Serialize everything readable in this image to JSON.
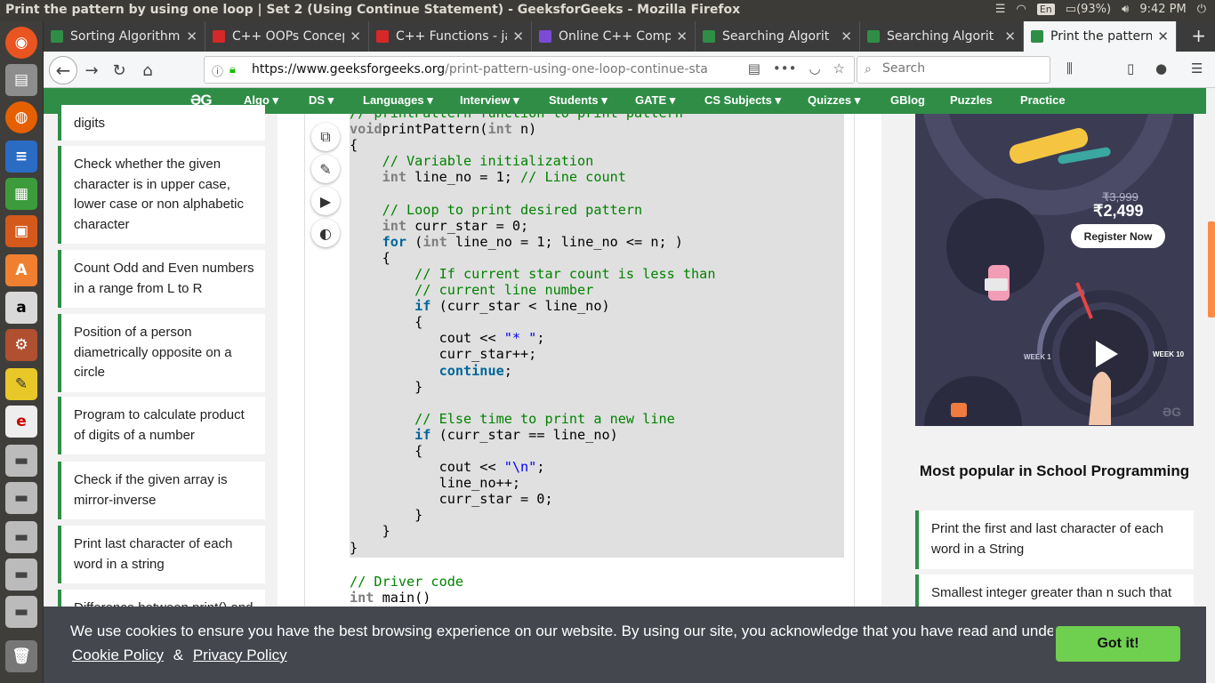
{
  "window": {
    "title": "Print the pattern by using one loop | Set 2 (Using Continue Statement) - GeeksforGeeks - Mozilla Firefox"
  },
  "system_tray": {
    "keyboard": "En",
    "battery": "(93%)",
    "clock": "9:42 PM"
  },
  "tabs": [
    {
      "title": "Sorting Algorithm",
      "icon_color": "#2f8d46",
      "icon": "gfg-icon",
      "active": false
    },
    {
      "title": "C++ OOPs Concep",
      "icon_color": "#d62828",
      "icon": "v-icon",
      "active": false
    },
    {
      "title": "C++ Functions - ja",
      "icon_color": "#d62828",
      "icon": "v-icon",
      "active": false
    },
    {
      "title": "Online C++ Compi",
      "icon_color": "#7b4bd8",
      "icon": "bolt-icon",
      "active": false
    },
    {
      "title": "Searching Algorit",
      "icon_color": "#2f8d46",
      "icon": "gfg-icon",
      "active": false
    },
    {
      "title": "Searching Algorit",
      "icon_color": "#2f8d46",
      "icon": "gfg-icon",
      "active": false
    },
    {
      "title": "Print the pattern b",
      "icon_color": "#2f8d46",
      "icon": "gfg-icon",
      "active": true
    }
  ],
  "navbar": {
    "url_domain": "https://www.geeksforgeeks.org",
    "url_path": "/print-pattern-using-one-loop-continue-sta",
    "search_placeholder": "Search"
  },
  "gfg_menu": {
    "logo": "ƏG",
    "items": [
      "Algo ▾",
      "DS ▾",
      "Languages ▾",
      "Interview ▾",
      "Students ▾",
      "GATE ▾",
      "CS Subjects ▾",
      "Quizzes ▾",
      "GBlog",
      "Puzzles",
      "Practice"
    ]
  },
  "left_sidebar": {
    "items": [
      "digits",
      "Check whether the given character is in upper case, lower case or non alphabetic character",
      "Count Odd and Even numbers in a range from L to R",
      "Position of a person diametrically opposite on a circle",
      "Program to calculate product of digits of a number",
      "Check if the given array is mirror-inverse",
      "Print last character of each word in a string",
      "Difference between print() and"
    ]
  },
  "code_lines": [
    [
      [
        "cm",
        "// printPattern function to print pattern"
      ]
    ],
    [
      [
        "ty",
        "void"
      ],
      [
        "",
        "printPattern("
      ],
      [
        "ty",
        "int"
      ],
      [
        "",
        " n)"
      ]
    ],
    [
      [
        "",
        "{"
      ]
    ],
    [
      [
        "",
        "    "
      ],
      [
        "cm",
        "// Variable initialization"
      ]
    ],
    [
      [
        "",
        "    "
      ],
      [
        "ty",
        "int"
      ],
      [
        "",
        " line_no = 1; "
      ],
      [
        "cm",
        "// Line count"
      ]
    ],
    [
      [
        "",
        ""
      ]
    ],
    [
      [
        "",
        "    "
      ],
      [
        "cm",
        "// Loop to print desired pattern"
      ]
    ],
    [
      [
        "",
        "    "
      ],
      [
        "ty",
        "int"
      ],
      [
        "",
        " curr_star = 0;"
      ]
    ],
    [
      [
        "",
        "    "
      ],
      [
        "kw",
        "for"
      ],
      [
        "",
        " ("
      ],
      [
        "ty",
        "int"
      ],
      [
        "",
        " line_no = 1; line_no <= n; )"
      ]
    ],
    [
      [
        "",
        "    {"
      ]
    ],
    [
      [
        "",
        "        "
      ],
      [
        "cm",
        "// If current star count is less than"
      ]
    ],
    [
      [
        "",
        "        "
      ],
      [
        "cm",
        "// current line number"
      ]
    ],
    [
      [
        "",
        "        "
      ],
      [
        "kw",
        "if"
      ],
      [
        "",
        " (curr_star < line_no)"
      ]
    ],
    [
      [
        "",
        "        {"
      ]
    ],
    [
      [
        "",
        "           cout << "
      ],
      [
        "st",
        "\"* \""
      ],
      [
        "",
        ";"
      ]
    ],
    [
      [
        "",
        "           curr_star++;"
      ]
    ],
    [
      [
        "",
        "           "
      ],
      [
        "kw",
        "continue"
      ],
      [
        "",
        ";"
      ]
    ],
    [
      [
        "",
        "        }"
      ]
    ],
    [
      [
        "",
        ""
      ]
    ],
    [
      [
        "",
        "        "
      ],
      [
        "cm",
        "// Else time to print a new line"
      ]
    ],
    [
      [
        "",
        "        "
      ],
      [
        "kw",
        "if"
      ],
      [
        "",
        " (curr_star == line_no)"
      ]
    ],
    [
      [
        "",
        "        {"
      ]
    ],
    [
      [
        "",
        "           cout << "
      ],
      [
        "st",
        "\"\\n\""
      ],
      [
        "",
        ";"
      ]
    ],
    [
      [
        "",
        "           line_no++;"
      ]
    ],
    [
      [
        "",
        "           curr_star = 0;"
      ]
    ],
    [
      [
        "",
        "        }"
      ]
    ],
    [
      [
        "",
        "    }"
      ]
    ],
    [
      [
        "",
        "}"
      ]
    ]
  ],
  "code_after": [
    [
      [
        "cm",
        "// Driver code"
      ]
    ],
    [
      [
        "ty",
        "int"
      ],
      [
        "",
        " main()"
      ]
    ]
  ],
  "ad": {
    "old_price": "₹3,999",
    "new_price": "₹2,499",
    "register_label": "Register Now",
    "week_start": "WEEK 1",
    "week_end": "WEEK 10",
    "corner_logo": "ƏG"
  },
  "right_sidebar": {
    "heading": "Most popular in School Programming",
    "items": [
      "Print the first and last character of each word in a String",
      "Smallest integer greater than n such that"
    ]
  },
  "cookie": {
    "message": "We use cookies to ensure you have the best browsing experience on our website. By using our site, you acknowledge that you have read and understood our",
    "cookie_policy": "Cookie Policy",
    "amp": "&",
    "privacy_policy": "Privacy Policy",
    "got_it": "Got it!"
  },
  "colors": {
    "gfg_green": "#2f8d46",
    "cookie_bg": "#44474d",
    "got_it": "#6fcf4f",
    "code_bg": "#e0e0e0"
  }
}
